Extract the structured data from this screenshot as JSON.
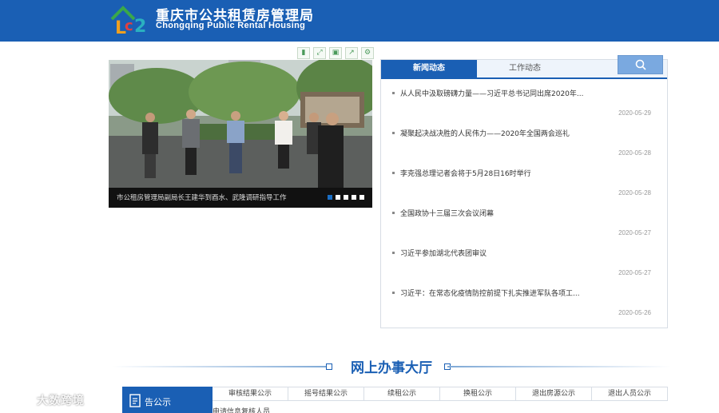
{
  "header": {
    "title": "重庆市公共租赁房管理局",
    "subtitle": "Chongqing Public Rental Housing"
  },
  "carousel": {
    "caption": "市公租房管理局副局长王建华到酉水、武隆调研指导工作",
    "dot_count": 5,
    "active_dot": 1
  },
  "news": {
    "tabs": [
      "新闻动态",
      "工作动态"
    ],
    "active_tab": 0,
    "items": [
      {
        "title": "从人民中汲取磅礴力量——习近平总书记同出席2020年...",
        "date": "2020-05-29"
      },
      {
        "title": "凝聚起决战决胜的人民伟力——2020年全国两会巡礼",
        "date": "2020-05-28"
      },
      {
        "title": "李克强总理记者会将于5月28日16时举行",
        "date": "2020-05-28"
      },
      {
        "title": "全国政协十三届三次会议闭幕",
        "date": "2020-05-27"
      },
      {
        "title": "习近平参加湖北代表团审议",
        "date": "2020-05-27"
      },
      {
        "title": "习近平：在常态化疫情防控前提下扎实推进军队各项工...",
        "date": "2020-05-26"
      }
    ]
  },
  "hall": {
    "title": "网上办事大厅"
  },
  "notice": {
    "label": "告公示",
    "tabs": [
      "审核结果公示",
      "摇号结果公示",
      "续租公示",
      "换租公示",
      "退出房源公示",
      "退出人员公示"
    ],
    "row_text": "申请信息复核人员"
  },
  "watermark": {
    "text": "大数跨境"
  },
  "colors": {
    "brand_blue": "#1a5fb4",
    "search_blue": "#7aa9e0"
  }
}
